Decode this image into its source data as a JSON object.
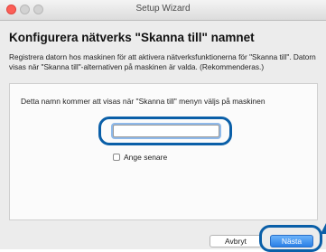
{
  "window": {
    "title": "Setup Wizard"
  },
  "heading": "Konfigurera nätverks \"Skanna till\" namnet",
  "description": "Registrera datorn hos maskinen för att aktivera nätverksfunktionerna för \"Skanna till\". Datorn visas när \"Skanna till\"-alternativen på maskinen är valda. (Rekommenderas.)",
  "panel": {
    "prompt": "Detta namn kommer att visas när \"Skanna till\" menyn väljs på maskinen",
    "name_input": {
      "value": ""
    },
    "checkbox": {
      "label": "Ange senare",
      "checked": false
    }
  },
  "buttons": {
    "cancel": "Avbryt",
    "next": "Nästa"
  },
  "colors": {
    "highlight": "#0a5fa8",
    "primary_button": "#2a7fe6",
    "close_button": "#fc5f57"
  },
  "icons": [
    "close-traffic-light",
    "minimize-traffic-light",
    "zoom-traffic-light",
    "pointer-arrow-icon"
  ]
}
